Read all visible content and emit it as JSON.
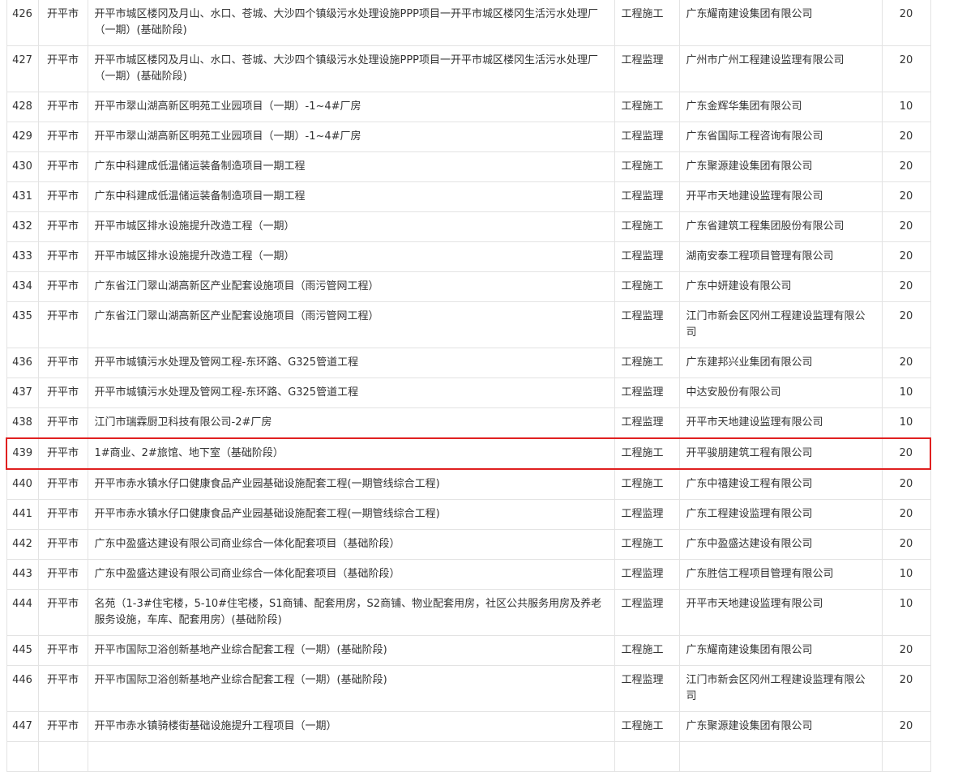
{
  "table": {
    "rows": [
      {
        "no": "426",
        "city": "开平市",
        "project": "开平市城区楼冈及月山、水口、苍城、大沙四个镇级污水处理设施PPP项目一开平市城区楼冈生活污水处理厂（一期）(基础阶段)",
        "type": "工程施工",
        "company": "广东耀南建设集团有限公司",
        "score": "20"
      },
      {
        "no": "427",
        "city": "开平市",
        "project": "开平市城区楼冈及月山、水口、苍城、大沙四个镇级污水处理设施PPP项目一开平市城区楼冈生活污水处理厂（一期）(基础阶段)",
        "type": "工程监理",
        "company": "广州市广州工程建设监理有限公司",
        "score": "20"
      },
      {
        "no": "428",
        "city": "开平市",
        "project": "开平市翠山湖高新区明苑工业园项目（一期）-1~4#厂房",
        "type": "工程施工",
        "company": "广东金辉华集团有限公司",
        "score": "10"
      },
      {
        "no": "429",
        "city": "开平市",
        "project": "开平市翠山湖高新区明苑工业园项目（一期）-1~4#厂房",
        "type": "工程监理",
        "company": "广东省国际工程咨询有限公司",
        "score": "20"
      },
      {
        "no": "430",
        "city": "开平市",
        "project": "广东中科建成低温储运装备制造项目一期工程",
        "type": "工程施工",
        "company": "广东聚源建设集团有限公司",
        "score": "20"
      },
      {
        "no": "431",
        "city": "开平市",
        "project": "广东中科建成低温储运装备制造项目一期工程",
        "type": "工程监理",
        "company": "开平市天地建设监理有限公司",
        "score": "20"
      },
      {
        "no": "432",
        "city": "开平市",
        "project": "开平市城区排水设施提升改造工程（一期）",
        "type": "工程施工",
        "company": "广东省建筑工程集团股份有限公司",
        "score": "20"
      },
      {
        "no": "433",
        "city": "开平市",
        "project": "开平市城区排水设施提升改造工程（一期）",
        "type": "工程监理",
        "company": "湖南安泰工程项目管理有限公司",
        "score": "20"
      },
      {
        "no": "434",
        "city": "开平市",
        "project": "广东省江门翠山湖高新区产业配套设施项目（雨污管网工程）",
        "type": "工程施工",
        "company": "广东中妍建设有限公司",
        "score": "20"
      },
      {
        "no": "435",
        "city": "开平市",
        "project": "广东省江门翠山湖高新区产业配套设施项目（雨污管网工程）",
        "type": "工程监理",
        "company": "江门市新会区冈州工程建设监理有限公司",
        "score": "20"
      },
      {
        "no": "436",
        "city": "开平市",
        "project": "开平市城镇污水处理及管网工程-东环路、G325管道工程",
        "type": "工程施工",
        "company": "广东建邦兴业集团有限公司",
        "score": "20"
      },
      {
        "no": "437",
        "city": "开平市",
        "project": "开平市城镇污水处理及管网工程-东环路、G325管道工程",
        "type": "工程监理",
        "company": "中达安股份有限公司",
        "score": "10"
      },
      {
        "no": "438",
        "city": "开平市",
        "project": "江门市瑞霖厨卫科技有限公司-2#厂房",
        "type": "工程监理",
        "company": "开平市天地建设监理有限公司",
        "score": "10"
      },
      {
        "no": "439",
        "city": "开平市",
        "project": "1#商业、2#旅馆、地下室（基础阶段）",
        "type": "工程施工",
        "company": "开平骏朋建筑工程有限公司",
        "score": "20"
      },
      {
        "no": "440",
        "city": "开平市",
        "project": "开平市赤水镇水仔口健康食品产业园基础设施配套工程(一期管线综合工程)",
        "type": "工程施工",
        "company": "广东中禧建设工程有限公司",
        "score": "20"
      },
      {
        "no": "441",
        "city": "开平市",
        "project": "开平市赤水镇水仔口健康食品产业园基础设施配套工程(一期管线综合工程)",
        "type": "工程监理",
        "company": "广东工程建设监理有限公司",
        "score": "20"
      },
      {
        "no": "442",
        "city": "开平市",
        "project": "广东中盈盛达建设有限公司商业综合一体化配套项目（基础阶段）",
        "type": "工程施工",
        "company": "广东中盈盛达建设有限公司",
        "score": "20"
      },
      {
        "no": "443",
        "city": "开平市",
        "project": "广东中盈盛达建设有限公司商业综合一体化配套项目（基础阶段）",
        "type": "工程监理",
        "company": "广东胜信工程项目管理有限公司",
        "score": "10"
      },
      {
        "no": "444",
        "city": "开平市",
        "project": "名苑（1-3#住宅楼，5-10#住宅楼，S1商铺、配套用房，S2商铺、物业配套用房，社区公共服务用房及养老服务设施，车库、配套用房）(基础阶段)",
        "type": "工程监理",
        "company": "开平市天地建设监理有限公司",
        "score": "10"
      },
      {
        "no": "445",
        "city": "开平市",
        "project": "开平市国际卫浴创新基地产业综合配套工程（一期）(基础阶段)",
        "type": "工程施工",
        "company": "广东耀南建设集团有限公司",
        "score": "20"
      },
      {
        "no": "446",
        "city": "开平市",
        "project": "开平市国际卫浴创新基地产业综合配套工程（一期）(基础阶段)",
        "type": "工程监理",
        "company": "江门市新会区冈州工程建设监理有限公司",
        "score": "20"
      },
      {
        "no": "447",
        "city": "开平市",
        "project": "开平市赤水镇骑楼街基础设施提升工程项目（一期）",
        "type": "工程施工",
        "company": "广东聚源建设集团有限公司",
        "score": "20"
      },
      {
        "no": "",
        "city": "",
        "project": "",
        "type": "",
        "company": "",
        "score": ""
      }
    ]
  }
}
